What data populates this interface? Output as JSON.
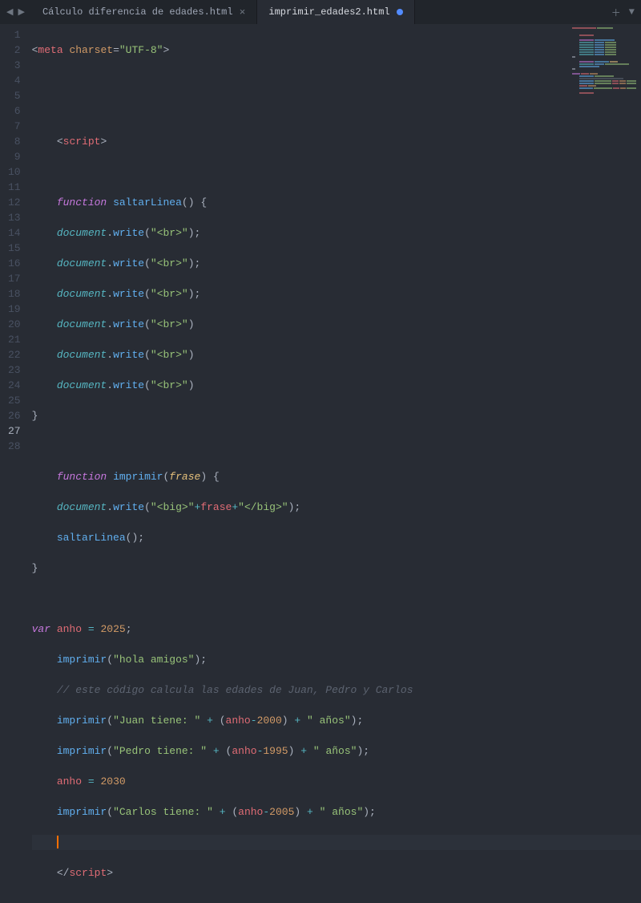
{
  "tabs": {
    "items": [
      {
        "label": "Cálculo diferencia de edades.html",
        "active": false,
        "dirty": false
      },
      {
        "label": "imprimir_edades2.html",
        "active": true,
        "dirty": true
      }
    ]
  },
  "editor": {
    "line_numbers": [
      "1",
      "2",
      "3",
      "4",
      "5",
      "6",
      "7",
      "8",
      "9",
      "10",
      "11",
      "12",
      "13",
      "14",
      "15",
      "16",
      "17",
      "18",
      "19",
      "20",
      "21",
      "22",
      "23",
      "24",
      "25",
      "26",
      "27",
      "28"
    ],
    "current_line": 27
  },
  "code": {
    "l1_p": "<",
    "l1_tag": "meta",
    "l1_sp": " ",
    "l1_attr": "charset",
    "l1_eq": "=",
    "l1_str": "\"UTF-8\"",
    "l1_p2": ">",
    "l4_p": "<",
    "l4_tag": "script",
    "l4_p2": ">",
    "l6_kw": "function",
    "l6_sp": " ",
    "l6_fn": "saltarLinea",
    "l6_p": "()",
    "l6_sp2": " ",
    "l6_brace": "{",
    "l7_obj": "document",
    "l7_dot": ".",
    "l7_fn": "write",
    "l7_p": "(",
    "l7_str": "\"<br>\"",
    "l7_p2": ");",
    "l8_obj": "document",
    "l8_dot": ".",
    "l8_fn": "write",
    "l8_p": "(",
    "l8_str": "\"<br>\"",
    "l8_p2": ");",
    "l9_obj": "document",
    "l9_dot": ".",
    "l9_fn": "write",
    "l9_p": "(",
    "l9_str": "\"<br>\"",
    "l9_p2": ");",
    "l10_obj": "document",
    "l10_dot": ".",
    "l10_fn": "write",
    "l10_p": "(",
    "l10_str": "\"<br>\"",
    "l10_p2": ")",
    "l11_obj": "document",
    "l11_dot": ".",
    "l11_fn": "write",
    "l11_p": "(",
    "l11_str": "\"<br>\"",
    "l11_p2": ")",
    "l12_obj": "document",
    "l12_dot": ".",
    "l12_fn": "write",
    "l12_p": "(",
    "l12_str": "\"<br>\"",
    "l12_p2": ")",
    "l13_brace": "}",
    "l15_kw": "function",
    "l15_sp": " ",
    "l15_fn": "imprimir",
    "l15_p": "(",
    "l15_param": "frase",
    "l15_p2": ")",
    "l15_sp2": " ",
    "l15_brace": "{",
    "l16_obj": "document",
    "l16_dot": ".",
    "l16_fn": "write",
    "l16_p": "(",
    "l16_str1": "\"<big>\"",
    "l16_op1": "+",
    "l16_var": "frase",
    "l16_op2": "+",
    "l16_str2": "\"</big>\"",
    "l16_p2": ");",
    "l17_fn": "saltarLinea",
    "l17_p": "();",
    "l18_brace": "}",
    "l20_kw": "var",
    "l20_sp": " ",
    "l20_var": "anho",
    "l20_sp2": " ",
    "l20_op": "=",
    "l20_sp3": " ",
    "l20_num": "2025",
    "l20_p": ";",
    "l21_fn": "imprimir",
    "l21_p": "(",
    "l21_str": "\"hola amigos\"",
    "l21_p2": ");",
    "l22_cmt": "// este código calcula las edades de Juan, Pedro y Carlos",
    "l23_fn": "imprimir",
    "l23_p": "(",
    "l23_str1": "\"Juan tiene: \"",
    "l23_sp1": " ",
    "l23_op1": "+",
    "l23_sp2": " ",
    "l23_p2": "(",
    "l23_var": "anho",
    "l23_op2": "-",
    "l23_num": "2000",
    "l23_p3": ")",
    "l23_sp3": " ",
    "l23_op3": "+",
    "l23_sp4": " ",
    "l23_str2": "\" años\"",
    "l23_p4": ");",
    "l24_fn": "imprimir",
    "l24_p": "(",
    "l24_str1": "\"Pedro tiene: \"",
    "l24_sp1": " ",
    "l24_op1": "+",
    "l24_sp2": " ",
    "l24_p2": "(",
    "l24_var": "anho",
    "l24_op2": "-",
    "l24_num": "1995",
    "l24_p3": ")",
    "l24_sp3": " ",
    "l24_op3": "+",
    "l24_sp4": " ",
    "l24_str2": "\" años\"",
    "l24_p4": ");",
    "l25_var": "anho",
    "l25_sp": " ",
    "l25_op": "=",
    "l25_sp2": " ",
    "l25_num": "2030",
    "l26_fn": "imprimir",
    "l26_p": "(",
    "l26_str1": "\"Carlos tiene: \"",
    "l26_sp1": " ",
    "l26_op1": "+",
    "l26_sp2": " ",
    "l26_p2": "(",
    "l26_var": "anho",
    "l26_op2": "-",
    "l26_num": "2005",
    "l26_p3": ")",
    "l26_sp3": " ",
    "l26_op3": "+",
    "l26_sp4": " ",
    "l26_str2": "\" años\"",
    "l26_p4": ");",
    "l28_p": "</",
    "l28_tag": "script",
    "l28_p2": ">"
  }
}
